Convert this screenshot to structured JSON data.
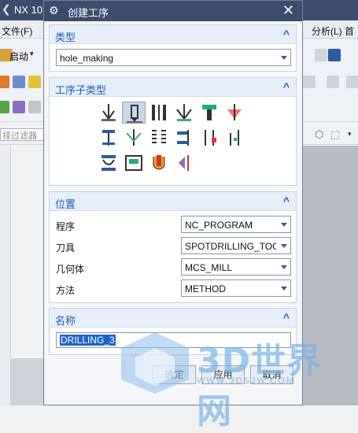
{
  "app": {
    "title": "NX 10",
    "back_glyph": "❮"
  },
  "menu": {
    "file": "文件(F)",
    "analysis": "分析(L)",
    "more": "首"
  },
  "toolbar": {
    "start_label": "启动"
  },
  "filter": {
    "placeholder": "择过滤器"
  },
  "dialog": {
    "title": "创建工序",
    "type_section": {
      "label": "类型",
      "value": "hole_making"
    },
    "subtype_section": {
      "label": "工序子类型"
    },
    "position_section": {
      "label": "位置",
      "rows": [
        {
          "label": "程序",
          "value": "NC_PROGRAM"
        },
        {
          "label": "刀具",
          "value": "SPOTDRILLING_TOC"
        },
        {
          "label": "几何体",
          "value": "MCS_MILL"
        },
        {
          "label": "方法",
          "value": "METHOD"
        }
      ]
    },
    "name_section": {
      "label": "名称",
      "value": "DRILLING_3"
    },
    "buttons": {
      "ok": "确定",
      "apply": "应用",
      "cancel": "取消"
    }
  },
  "watermark": {
    "text": "3D世界网",
    "url": "WWW.3DSJW.COM"
  },
  "colors": {
    "title_bar": "#3b4d6b",
    "section_label": "#1f5fb5",
    "selection": "#1e64c8"
  }
}
